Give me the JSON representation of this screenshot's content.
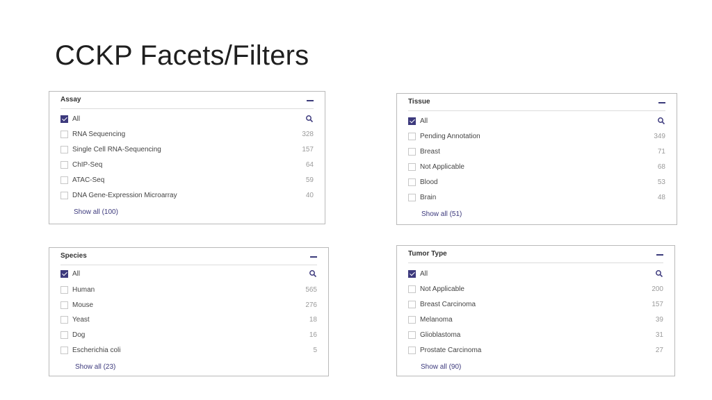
{
  "slide": {
    "title": "CCKP Facets/Filters"
  },
  "panels": [
    {
      "title": "Assay",
      "all_label": "All",
      "items": [
        {
          "label": "RNA Sequencing",
          "count": "328"
        },
        {
          "label": "Single Cell RNA-Sequencing",
          "count": "157"
        },
        {
          "label": "ChIP-Seq",
          "count": "64"
        },
        {
          "label": "ATAC-Seq",
          "count": "59"
        },
        {
          "label": "DNA Gene-Expression Microarray",
          "count": "40"
        }
      ],
      "show_all": "Show all (100)"
    },
    {
      "title": "Tissue",
      "all_label": "All",
      "items": [
        {
          "label": "Pending Annotation",
          "count": "349"
        },
        {
          "label": "Breast",
          "count": "71"
        },
        {
          "label": "Not Applicable",
          "count": "68"
        },
        {
          "label": "Blood",
          "count": "53"
        },
        {
          "label": "Brain",
          "count": "48"
        }
      ],
      "show_all": "Show all (51)"
    },
    {
      "title": "Species",
      "all_label": "All",
      "items": [
        {
          "label": "Human",
          "count": "565"
        },
        {
          "label": "Mouse",
          "count": "276"
        },
        {
          "label": "Yeast",
          "count": "18"
        },
        {
          "label": "Dog",
          "count": "16"
        },
        {
          "label": "Escherichia coli",
          "count": "5"
        }
      ],
      "show_all": "Show all (23)"
    },
    {
      "title": "Tumor Type",
      "all_label": "All",
      "items": [
        {
          "label": "Not Applicable",
          "count": "200"
        },
        {
          "label": "Breast Carcinoma",
          "count": "157"
        },
        {
          "label": "Melanoma",
          "count": "39"
        },
        {
          "label": "Glioblastoma",
          "count": "31"
        },
        {
          "label": "Prostate Carcinoma",
          "count": "27"
        }
      ],
      "show_all": "Show all (90)"
    }
  ],
  "colors": {
    "accent": "#3d3a7d",
    "count": "#9a9a9a",
    "border": "#b9b9b9"
  },
  "icons": {
    "search": "search-icon",
    "collapse": "collapse-icon"
  }
}
